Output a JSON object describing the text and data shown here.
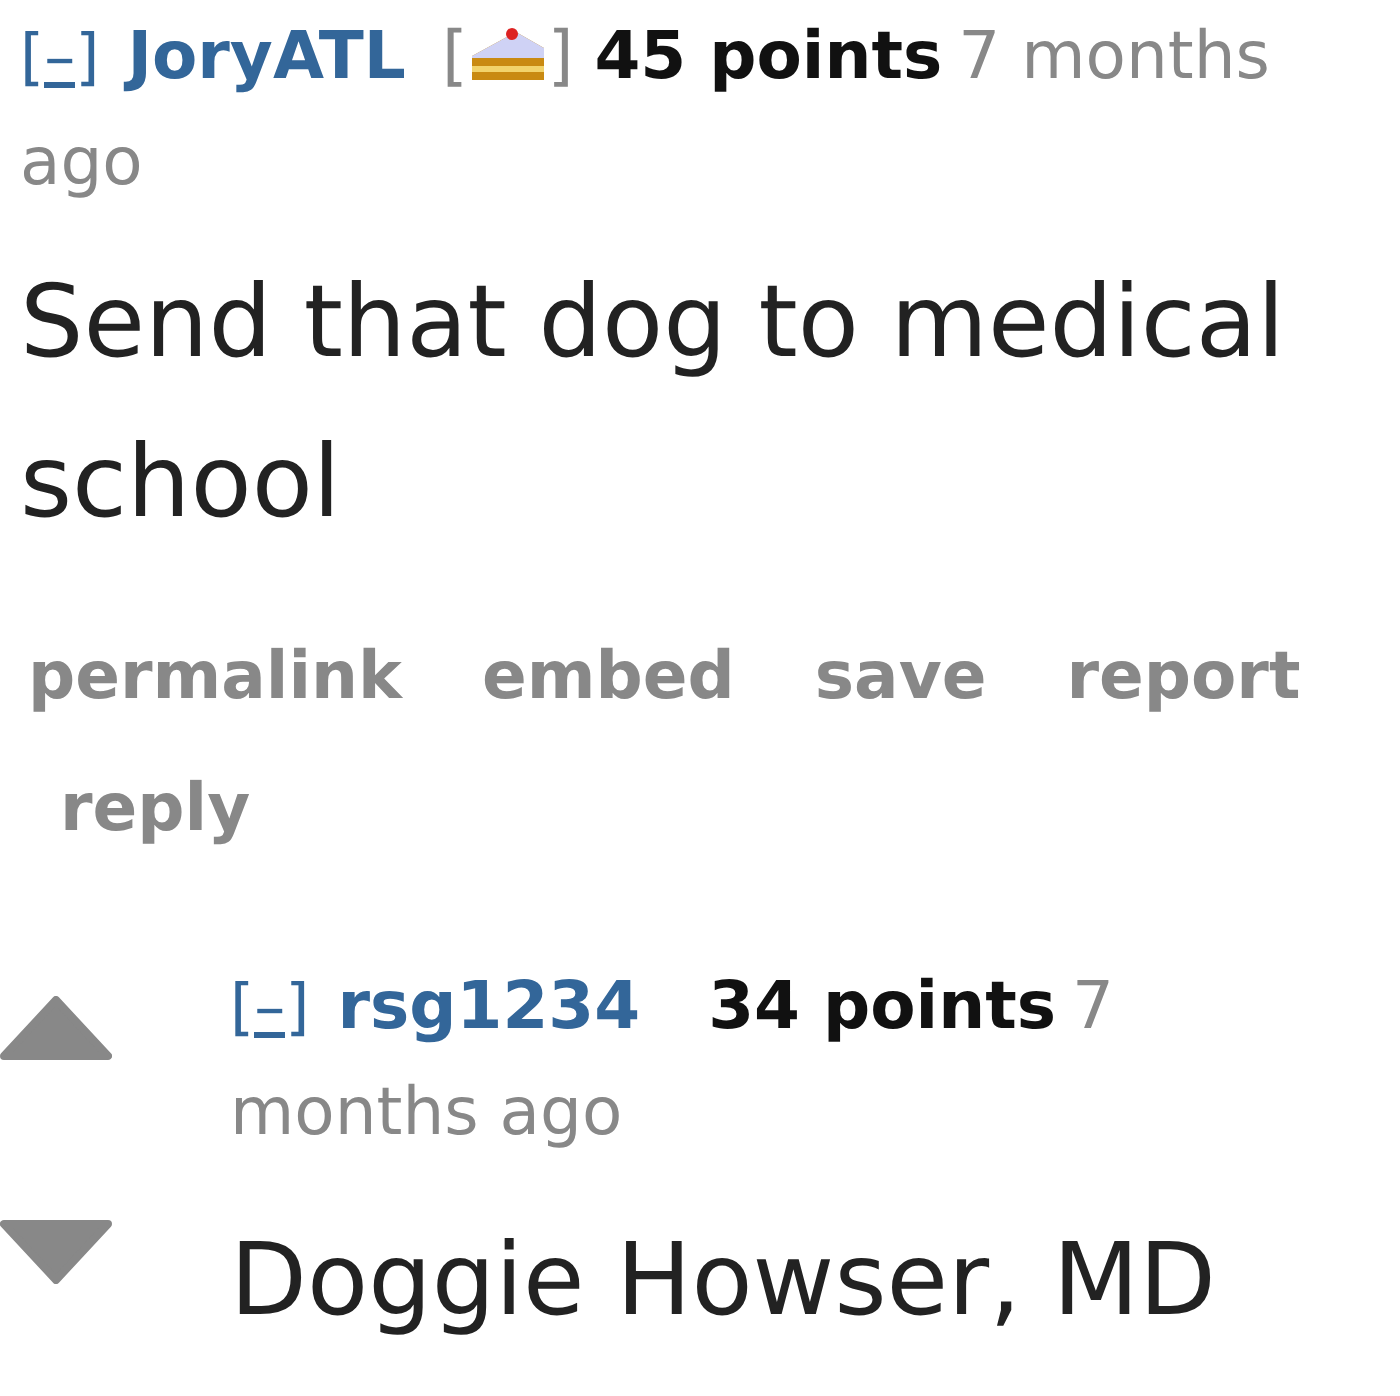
{
  "comments": [
    {
      "collapse": "[–]",
      "author": "JoryATL",
      "flair": {
        "kind": "cake",
        "open": "[",
        "close": "]"
      },
      "points": "45 points",
      "time": [
        "7 months",
        "ago"
      ],
      "body": "Send that dog to medical school",
      "actions": [
        "permalink",
        "embed",
        "save",
        "report",
        "reply"
      ],
      "children": [
        {
          "collapse": "[–]",
          "author": "rsg1234",
          "points": "34 points",
          "time": [
            "7",
            "months ago"
          ],
          "body": "Doggie Howser, MD",
          "votes": true
        }
      ]
    }
  ]
}
